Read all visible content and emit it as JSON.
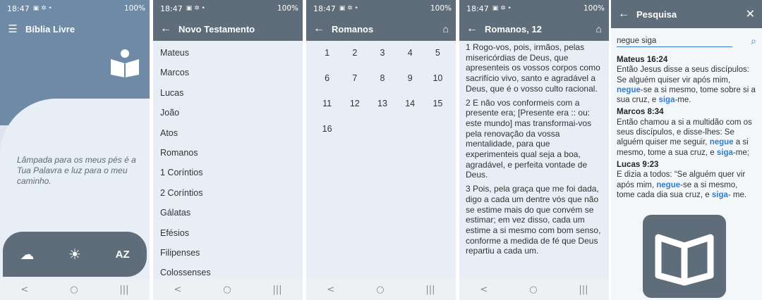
{
  "status": {
    "time": "18:47",
    "battery": "100%"
  },
  "home": {
    "menu_icon": "menu-icon",
    "title": "Bíblia Livre",
    "verse": "Lâmpada para os meus pés é a Tua Palavra e luz para o meu caminho.",
    "actions": [
      {
        "icon": "cloud-icon",
        "glyph": "☁"
      },
      {
        "icon": "brightness-icon",
        "glyph": "☀"
      },
      {
        "icon": "sort-az-icon",
        "glyph": "AZ"
      }
    ]
  },
  "books": {
    "title": "Novo Testamento",
    "items": [
      "Mateus",
      "Marcos",
      "Lucas",
      "João",
      "Atos",
      "Romanos",
      "1 Coríntios",
      "2 Coríntios",
      "Gálatas",
      "Efésios",
      "Filipenses",
      "Colossenses"
    ]
  },
  "chapters": {
    "title": "Romanos",
    "numbers": [
      "1",
      "2",
      "3",
      "4",
      "5",
      "6",
      "7",
      "8",
      "9",
      "10",
      "11",
      "12",
      "13",
      "14",
      "15",
      "16"
    ]
  },
  "reading": {
    "title": "Romanos, 12",
    "verses": [
      "1 Rogo-vos, pois, irmãos, pelas misericórdias de Deus, que apresenteis os vossos corpos como sacrifício vivo, santo e agradável a Deus, que é o vosso culto racional.",
      "2 E não vos conformeis com a presente era; [Presente era :: ou: este mundo] mas transformai-vos pela renovação da vossa mentalidade, para que experimenteis qual seja a boa, agradável, e perfeita vontade de Deus.",
      "3 Pois, pela graça que me foi dada, digo a cada um dentre vós que não se estime mais do que convém se estimar; em vez disso, cada um estime a si mesmo com bom senso, conforme a medida de fé que Deus repartiu a cada um."
    ]
  },
  "search": {
    "title": "Pesquisa",
    "query": "negue siga",
    "results": [
      {
        "ref": "Mateus 16:24",
        "parts": [
          "Então Jesus disse a seus discípulos: Se alguém quiser vir após mim, ",
          "negue",
          "-se a si mesmo, tome sobre si a sua cruz, e ",
          "siga",
          "-me."
        ]
      },
      {
        "ref": "Marcos 8:34",
        "parts": [
          "Então chamou a si a multidão com os seus discípulos, e disse-lhes: Se alguém quiser me seguir,  ",
          "negue",
          " a si mesmo, tome a sua cruz, e ",
          "siga",
          "-me;"
        ]
      },
      {
        "ref": "Lucas 9:23",
        "parts": [
          "E dizia a todos: “Se alguém quer vir após mim, ",
          "negue",
          "-se a si mesmo, tome cada dia sua cruz, e ",
          "siga",
          "- me."
        ]
      }
    ]
  },
  "nav": {
    "back": "<",
    "home": "○",
    "recents": "|||"
  }
}
